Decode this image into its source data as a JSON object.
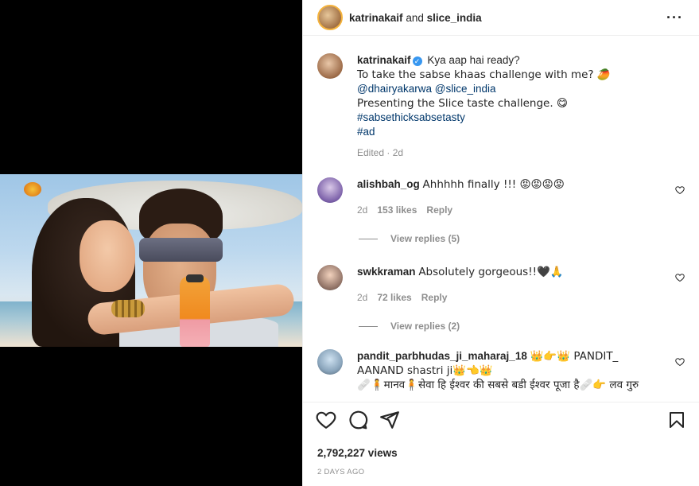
{
  "header": {
    "username": "katrinakaif",
    "connector": "and",
    "collaborator": "slice_india",
    "more_icon": "ellipsis-icon"
  },
  "caption": {
    "username": "katrinakaif",
    "line1": "Kya aap hai ready?",
    "line2": "To take the sabse khaas challenge with me? 🥭",
    "mentions": "@dhairyakarwa @slice_india",
    "line4": "Presenting the Slice taste challenge. 😋",
    "hashtag1": "#sabsethicksabsetasty",
    "hashtag2": "#ad",
    "meta": "Edited · 2d"
  },
  "comments": [
    {
      "username": "alishbah_og",
      "text": "Ahhhhh finally !!! 😡😡😡😡",
      "age": "2d",
      "likes": "153 likes",
      "reply": "Reply",
      "view_replies": "View replies (5)"
    },
    {
      "username": "swkkraman",
      "text": "Absolutely gorgeous!!🖤🙏",
      "age": "2d",
      "likes": "72 likes",
      "reply": "Reply",
      "view_replies": "View replies (2)"
    },
    {
      "username": "pandit_parbhudas_ji_maharaj_18",
      "text": "👑👉👑 PANDIT_ AANAND shastri ji👑👈👑",
      "text2": "🩹🧍मानव🧍सेवा हि ईश्वर की सबसे बडी ईश्वर पूजा है🩹👉 लव गुरु"
    }
  ],
  "stats": {
    "views": "2,792,227 views",
    "posted": "2 DAYS AGO"
  },
  "icons": {
    "like": "heart-icon",
    "comment": "comment-icon",
    "share": "share-icon",
    "save": "bookmark-icon"
  }
}
